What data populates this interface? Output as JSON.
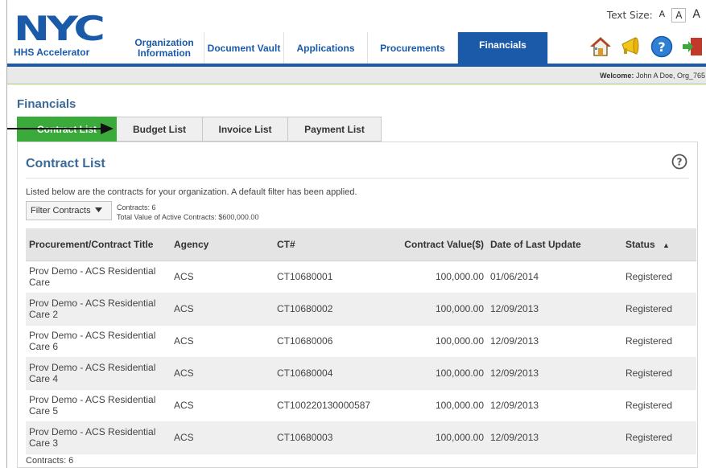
{
  "header": {
    "logo_text": "NYC",
    "logo_sub": "HHS Accelerator",
    "text_size_label": "Text Size:",
    "text_size_small": "A",
    "text_size_medium": "A",
    "text_size_large": "A"
  },
  "nav": {
    "tabs": [
      {
        "label": "Organization Information"
      },
      {
        "label": "Document Vault"
      },
      {
        "label": "Applications"
      },
      {
        "label": "Procurements"
      },
      {
        "label": "Financials"
      }
    ],
    "active": "Financials"
  },
  "icons": [
    "home-icon",
    "announcements-icon",
    "help-icon",
    "logout-icon"
  ],
  "welcome": {
    "label": "Welcome:",
    "user": "John A Doe, Org_765"
  },
  "page_title": "Financials",
  "subtabs": [
    {
      "label": "Contract List"
    },
    {
      "label": "Budget List"
    },
    {
      "label": "Invoice List"
    },
    {
      "label": "Payment List"
    }
  ],
  "panel": {
    "title": "Contract List",
    "description": "Listed below are the contracts for your organization. A default filter has been applied.",
    "filter_label": "Filter Contracts",
    "contracts_count": "Contracts: 6",
    "total_value": "Total Value of Active Contracts: $600,000.00",
    "footer_count": "Contracts: 6"
  },
  "table": {
    "columns": [
      "Procurement/Contract Title",
      "Agency",
      "CT#",
      "Contract Value($)",
      "Date of Last Update",
      "Status"
    ],
    "sort_indicator": "▲",
    "rows": [
      {
        "title": "Prov Demo - ACS Residential Care",
        "agency": "ACS",
        "ct": "CT10680001",
        "value": "100,000.00",
        "date": "01/06/2014",
        "status": "Registered"
      },
      {
        "title": "Prov Demo - ACS Residential Care 2",
        "agency": "ACS",
        "ct": "CT10680002",
        "value": "100,000.00",
        "date": "12/09/2013",
        "status": "Registered"
      },
      {
        "title": "Prov Demo - ACS Residential Care 6",
        "agency": "ACS",
        "ct": "CT10680006",
        "value": "100,000.00",
        "date": "12/09/2013",
        "status": "Registered"
      },
      {
        "title": "Prov Demo - ACS Residential Care 4",
        "agency": "ACS",
        "ct": "CT10680004",
        "value": "100,000.00",
        "date": "12/09/2013",
        "status": "Registered"
      },
      {
        "title": "Prov Demo - ACS Residential Care 5",
        "agency": "ACS",
        "ct": "CT100220130000587",
        "value": "100,000.00",
        "date": "12/09/2013",
        "status": "Registered"
      },
      {
        "title": "Prov Demo - ACS Residential Care 3",
        "agency": "ACS",
        "ct": "CT10680003",
        "value": "100,000.00",
        "date": "12/09/2013",
        "status": "Registered"
      }
    ]
  },
  "colors": {
    "brand_blue": "#1a5aa8",
    "active_green": "#3aab3a",
    "title_blue": "#3c6a98"
  }
}
